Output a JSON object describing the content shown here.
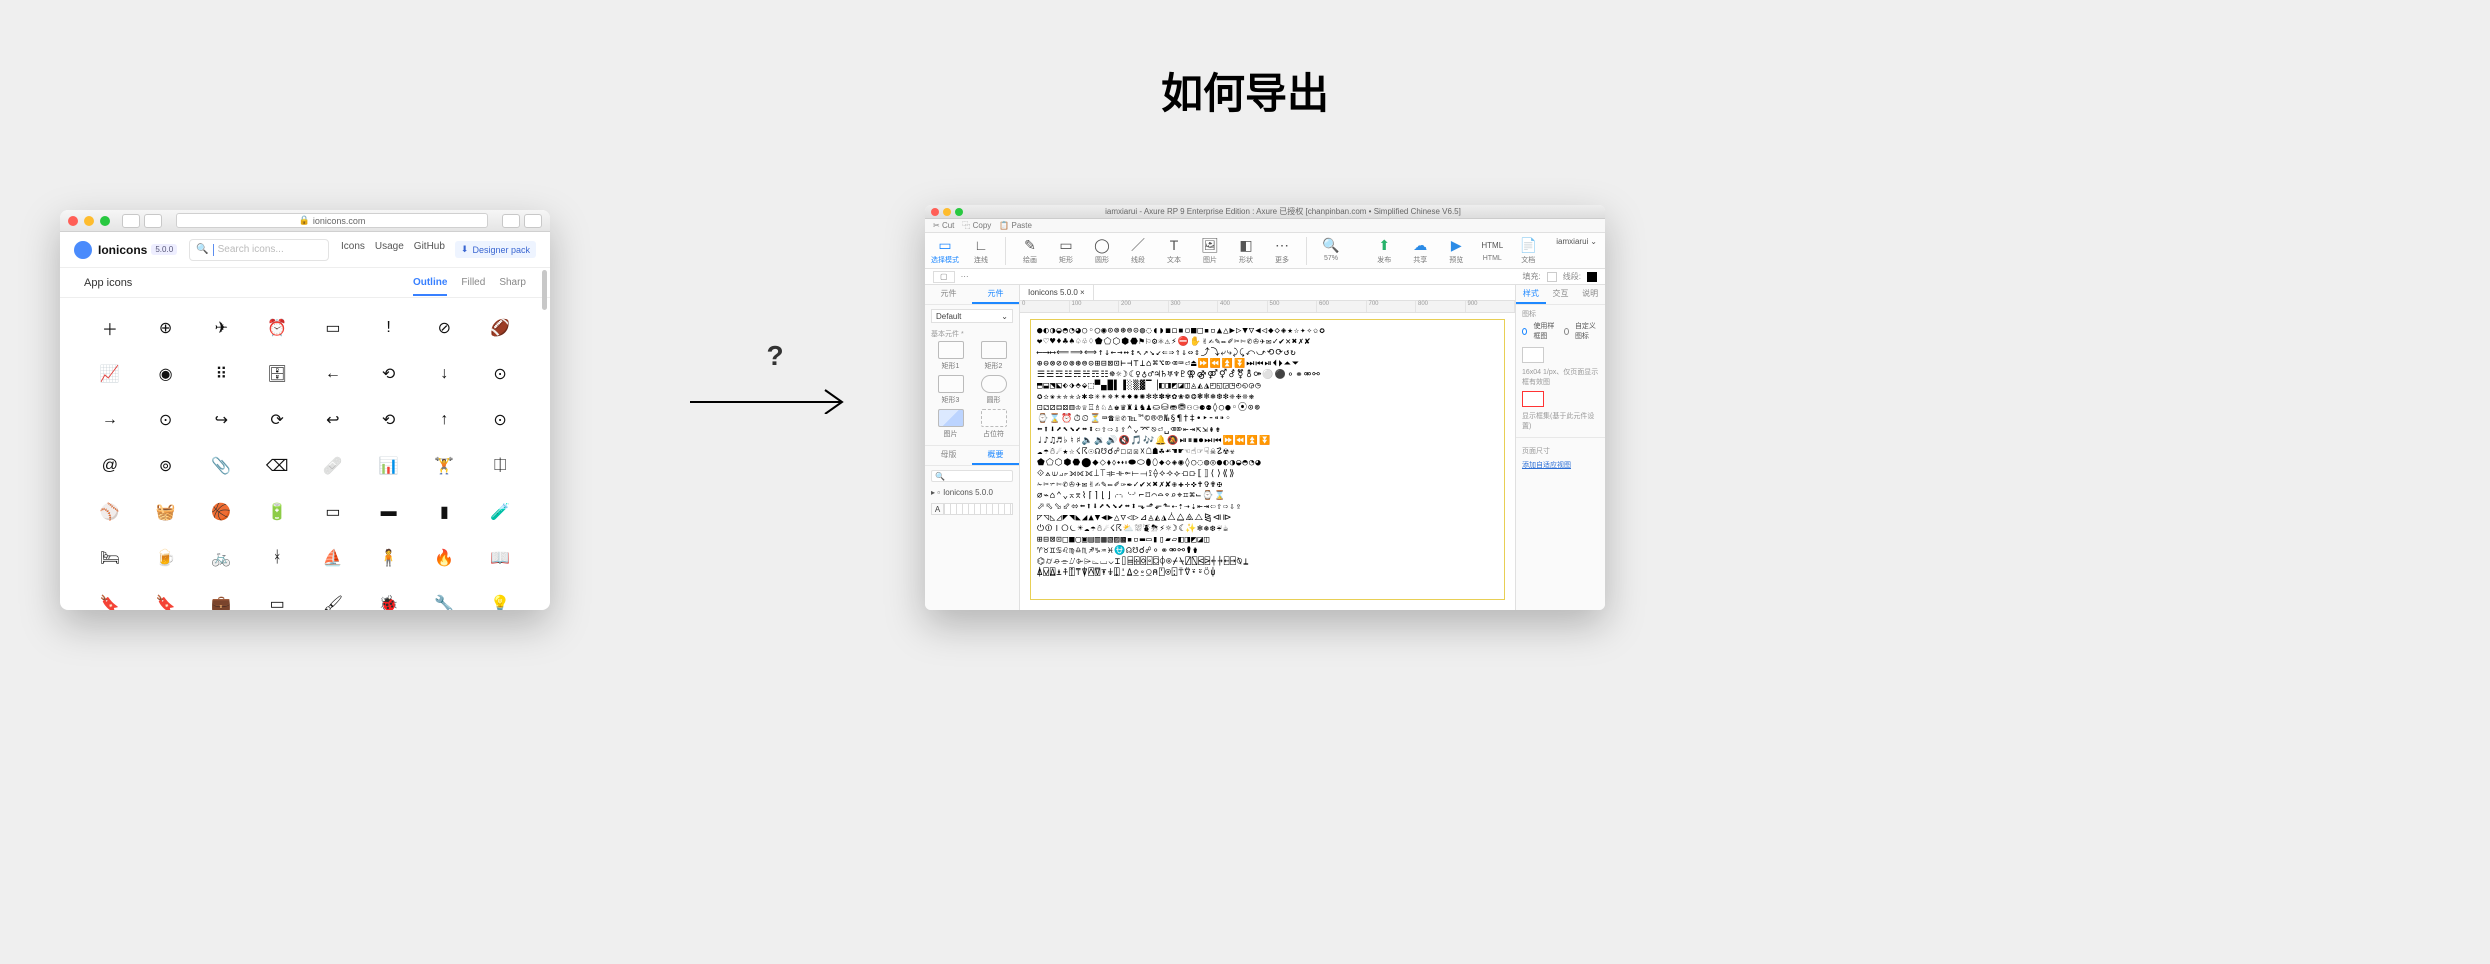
{
  "title": "如何导出",
  "arrow_q": "?",
  "left": {
    "url_lock": "🔒",
    "url": "ionicons.com",
    "logo": "Ionicons",
    "version": "5.0.0",
    "search_placeholder": "Search icons...",
    "nav": {
      "icons": "Icons",
      "usage": "Usage",
      "github": "GitHub",
      "designer_pack": "Designer pack"
    },
    "sub_left": "App icons",
    "sub_tabs": {
      "outline": "Outline",
      "filled": "Filled",
      "sharp": "Sharp"
    },
    "icon_names": [
      "add",
      "add-circle",
      "airplane",
      "alarm",
      "albums",
      "alert",
      "alert-circle",
      "american-football",
      "analytics",
      "aperture",
      "apps",
      "archive",
      "arrow-back",
      "arrow-back-circle",
      "arrow-down",
      "arrow-down-circle",
      "arrow-forward",
      "arrow-forward-circle",
      "arrow-redo",
      "arrow-redo-circle",
      "arrow-undo",
      "arrow-undo-circle",
      "arrow-up",
      "arrow-up-circle",
      "at",
      "at-circle",
      "attach",
      "backspace",
      "bandage",
      "bar-chart",
      "barbell",
      "barcode",
      "baseball",
      "basket",
      "basketball",
      "battery-charging",
      "battery-dead",
      "battery-full",
      "battery-half",
      "beaker",
      "bed",
      "beer",
      "bicycle",
      "bluetooth",
      "boat",
      "body",
      "bonfire",
      "book",
      "bookmark",
      "bookmarks",
      "briefcase",
      "browsers",
      "brush",
      "bug",
      "build",
      "bulb"
    ],
    "icon_glyphs": [
      "＋",
      "⊕",
      "✈",
      "⏰",
      "▭",
      "!",
      "⊘",
      "🏈",
      "📈",
      "◉",
      "⠿",
      "🗄",
      "←",
      "⟲",
      "↓",
      "⊙",
      "→",
      "⊙",
      "↪",
      "⟳",
      "↩",
      "⟲",
      "↑",
      "⊙",
      "@",
      "⊚",
      "📎",
      "⌫",
      "🩹",
      "📊",
      "🏋",
      "⎅",
      "⚾",
      "🧺",
      "🏀",
      "🔋",
      "▭",
      "▬",
      "▮",
      "🧪",
      "🛏",
      "🍺",
      "🚲",
      "ᚼ",
      "⛵",
      "🧍",
      "🔥",
      "📖",
      "🔖",
      "🔖",
      "💼",
      "▭",
      "🖌",
      "🐞",
      "🔧",
      "💡"
    ]
  },
  "right": {
    "titlebar": "iamxiarui - Axure RP 9 Enterprise Edition : Axure 已授权   [chanpinban.com • Simplified Chinese V6.5]",
    "clip": {
      "cut": "Cut",
      "copy": "Copy",
      "paste": "Paste"
    },
    "tools": {
      "select": "选择模式",
      "connect": "连线",
      "pen": "绘画",
      "rect": "矩形",
      "circle": "圆形",
      "line": "线段",
      "text": "文本",
      "image": "图片",
      "hotspot": "形状",
      "more": "更多",
      "zoom": "57%",
      "publish": "发布",
      "share": "共享",
      "preview": "预览",
      "html": "HTML",
      "docs": "文档"
    },
    "user": "iamxiarui",
    "style_line": {
      "fill": "填充:",
      "line": "线段:",
      "corner_label": "▢"
    },
    "lp": {
      "tabs": {
        "pages": "元件",
        "components": "元件"
      },
      "dropdown": "Default",
      "section_basic": "基本元件 *",
      "row1": {
        "a": "矩形1",
        "b": "矩形2"
      },
      "row2": {
        "a": "矩形3",
        "b": "圆形"
      },
      "row3": {
        "a": "图片",
        "b": "占位符"
      },
      "tabs2": {
        "master": "母版",
        "outline": "概要"
      },
      "tree": "Ionicons 5.0.0",
      "axbar": "A"
    },
    "canvas": {
      "tab": "Ionicons 5.0.0",
      "ruler": [
        "0",
        "100",
        "200",
        "300",
        "400",
        "500",
        "600",
        "700",
        "800",
        "900"
      ],
      "rows": [
        "●◐◑◒◓◔◕○◦◯◉⊙⊚⊛⊜⊝◍◌◖◗◼◻◾◽■□▪▫▲△▶▷▼▽◀◁◆◇◈★☆✦✧✩✪",
        "❤♡♥♦♣♠♤♧♢⬟⬠⬡⬢⬣⚑⚐⚙⚛⚠⚡⛔✋✌✍✎✏✐✂✄✆✇✈✉✓✔✕✖✗✘",
        "⟵⟶⟷⟸⟹⟺↑↓←→↔↕↖↗↘↙⇐⇒⇑⇓⇔⇕⤴⤵⤶⤷⤸⤹⤺⤻⟲⟳↺↻",
        "⊕⊖⊗⊘⊙⊚⊛⊜⊝⊞⊟⊠⊡⊢⊣⊤⊥⌂⌘⌥⌦⌫⌨⏎⏏⏩⏪⏫⏬⏭⏮⏯⏴⏵⏶⏷",
        "☰☱☲☳☴☵☶☷☸☼☽☾♀♁♂♃♄♅♆♇⚢⚣⚤⚥⚦⚧⚨⚩⚪⚫⚬⚭⚮⚯",
        "⬒⬓⬔⬕⬖⬗⬘⬙⬚▀▄█▌▐░▒▓▔▕◧◨◩◪◫◬◭◮◰◱◲◳◴◵◶◷",
        "✪✫✬✭✮✯✰✱✲✳✴✵✶✷✸✹✺✻✼✽✾✿❀❁❂❃❄❅❆❇❈❉❊❋",
        "⚀⚁⚂⚃⚄⚅♔♕♖♗♘♙♚♛♜♝♞♟⛀⛁⛂⛃⚇⚆⚈⚉◊○●◦⦿⊙⊚",
        "⌚⌛⏰⏱⏲⏳⌨☎☏✆℡™©®℗№§¶†‡•‣⁃⁌⁍◦",
        "⬅⬆⬇⬈⬉⬊⬋⬌⬍⇦⇧⇨⇩⇪⌃⌄⌤⎋⏎␣⌫⌦⇤⇥⇱⇲⇞⇟",
        "♩♪♫♬♭♮♯🔈🔉🔊🔇🎵🎶🔔🔕⏯⏸⏹⏺⏭⏮⏩⏪⏫⏬",
        "☁☂☃☄★☆☇☈☉☊☋☌☍☐☑☒☓☖☗☘☙☚☛☜☝☞☟☠☡☢☣",
        "⬟⬠⬡⬢⬣⬤⬥⬦⬧⬨⬩⬪⬫⬬⬭⬮⬯◆◇◈◉◊○◌◍◎●◐◑◒◓◔◕",
        "⟐⟑⟒⟓⟔⟕⟖⟗⟘⟙⟚⟛⟜⟝⟞⟟⟠⟡⟢⟣⟤⟥⟦⟧⟨⟩⟪⟫",
        "✁✂✃✄✆✇✈✉✌✍✎✏✐✑✒✓✔✕✖✗✘✙✚✛✜✝✞✟✠",
        "⌀⌁⌂⌃⌄⌅⌆⌇⌈⌉⌊⌋⌌⌍⌎⌏⌐⌑⌒⌓⌔⌕⌖⌗⌘⌙⌚⌛",
        "⬀⬁⬂⬃⬄⬅⬆⬇⬈⬉⬊⬋⬌⬍⬎⬏⬐⬑⇠⇡⇢⇣⇤⇥⇦⇧⇨⇩⇪",
        "◸◹◺◿◤◥◣◢▲▼◀▶△▽◁▷⊿◬◭◮⧊⧋⧌⧍⧎⧏⧐",
        "⏻⏼⏽⭘⏾☀☁☂☃☄☇☈⛅⛆⛇⛈⚡☼☽☾✨❄❅❆☔☕",
        "⊞⊟⊠⊡□■▢▣▤▥▦▧▨▩▪▫▬▭▮▯▰▱◧◨◩◪◫",
        "♈♉♊♋♌♍♎♏♐♑♒♓⛎☊☋☌☍⚬⚭⚮⚯⚰⚱",
        "⌬⌭⌮⌯⌰⌱⌲⌳⌴⌵⌶⌷⌸⌹⌺⌻⌼⌽⌾⌿⍀⍁⍂⍃⍄⍅⍆⍇⍈⍉⍊",
        "⍋⍌⍍⍎⍏⍐⍑⍒⍓⍔⍕⍖⍗⍘⍙⍚⍛⍜⍝⍞⍟⍠⍡⍢⍣⍤⍥⍦"
      ]
    },
    "rp": {
      "tabs": {
        "style": "样式",
        "interact": "交互",
        "notes": "说明"
      },
      "sec_image": "图标",
      "radio_sketch": "使用样框图",
      "radio_custom": "自定义图标",
      "sec_note1": "16x04   1/px、仅页面显示框有效图",
      "sec_note2": "显示框集(基于此元件设置)",
      "sec_pagesize": "页面尺寸",
      "link_add": "添加自适应视图"
    }
  }
}
